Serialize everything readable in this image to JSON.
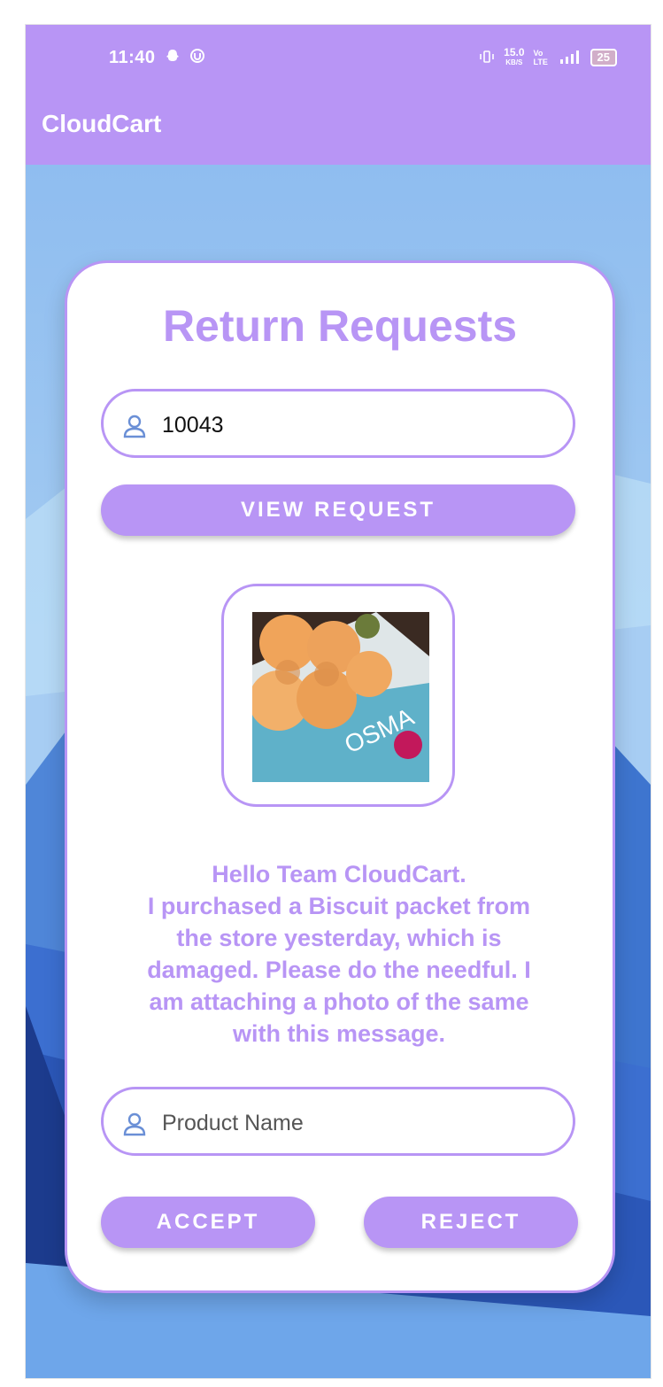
{
  "status_bar": {
    "time": "11:40",
    "net_speed": "15.0",
    "net_unit": "KB/S",
    "volte": "Vo LTE",
    "battery": "25"
  },
  "app_bar": {
    "title": "CloudCart"
  },
  "card": {
    "title": "Return Requests",
    "request_id_value": "10043",
    "view_request_label": "VIEW REQUEST",
    "message_lines": [
      "Hello Team CloudCart.",
      "I purchased a Biscuit packet from",
      "the store yesterday, which is",
      "damaged. Please do the needful. I",
      "am attaching a photo of the same",
      "with this message."
    ],
    "product_name_placeholder": "Product Name",
    "accept_label": "ACCEPT",
    "reject_label": "REJECT"
  },
  "colors": {
    "accent": "#b895f5",
    "background": "#8fbdf0",
    "card": "#ffffff"
  },
  "icons": {
    "status_left": [
      "snapchat-icon",
      "notification-icon"
    ],
    "status_right": [
      "vibrate-icon",
      "signal-icon",
      "battery-icon"
    ],
    "input_icon": "person-icon"
  }
}
